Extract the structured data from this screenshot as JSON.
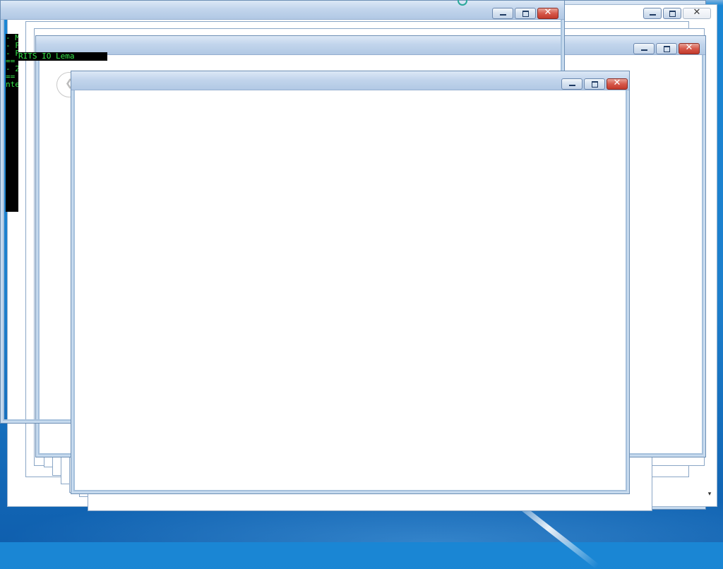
{
  "desktop": {
    "background": "#1a86d4"
  },
  "console": {
    "lines": [
      "- Mast",
      "- F",
      "- FRI",
      "==",
      "- 2",
      "==",
      "nte"
    ],
    "strip_text": "RITS IO Lema",
    "text_color": "#35e84a"
  },
  "windows": {
    "title": "",
    "controls": {
      "minimize_icon": "minimize-icon",
      "maximize_icon": "maximize-icon",
      "close_icon": "close-icon",
      "close_glyph": "✕"
    }
  },
  "scrollbar": {
    "down_arrow": "▾"
  }
}
